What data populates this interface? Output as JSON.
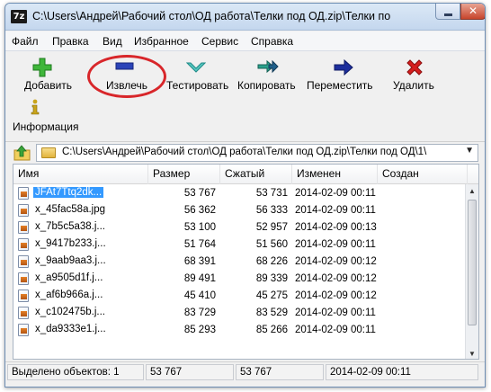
{
  "window": {
    "title": "C:\\Users\\Андрей\\Рабочий стол\\ОД работа\\Телки под ОД.zip\\Телки по",
    "app_icon_text": "7z",
    "close_glyph": "✕"
  },
  "menu": [
    "Файл",
    "Правка",
    "Вид",
    "Избранное",
    "Сервис",
    "Справка"
  ],
  "toolbar": {
    "add": "Добавить",
    "extract": "Извлечь",
    "test": "Тестировать",
    "copy": "Копировать",
    "move": "Переместить",
    "delete": "Удалить",
    "info": "Информация",
    "highlight_color": "#d8262a"
  },
  "address": {
    "path": "C:\\Users\\Андрей\\Рабочий стол\\ОД работа\\Телки под ОД.zip\\Телки под ОД\\1\\",
    "dropdown_glyph": "▼"
  },
  "columns": [
    "Имя",
    "Размер",
    "Сжатый",
    "Изменен",
    "Создан"
  ],
  "files": [
    {
      "name": "JFAt7Ttq2dk...",
      "size": "53 767",
      "packed": "53 731",
      "modified": "2014-02-09 00:11",
      "selected": true
    },
    {
      "name": "x_45fac58a.jpg",
      "size": "56 362",
      "packed": "56 333",
      "modified": "2014-02-09 00:11",
      "selected": false
    },
    {
      "name": "x_7b5c5a38.j...",
      "size": "53 100",
      "packed": "52 957",
      "modified": "2014-02-09 00:13",
      "selected": false
    },
    {
      "name": "x_9417b233.j...",
      "size": "51 764",
      "packed": "51 560",
      "modified": "2014-02-09 00:11",
      "selected": false
    },
    {
      "name": "x_9aab9aa3.j...",
      "size": "68 391",
      "packed": "68 226",
      "modified": "2014-02-09 00:12",
      "selected": false
    },
    {
      "name": "x_a9505d1f.j...",
      "size": "89 491",
      "packed": "89 339",
      "modified": "2014-02-09 00:12",
      "selected": false
    },
    {
      "name": "x_af6b966a.j...",
      "size": "45 410",
      "packed": "45 275",
      "modified": "2014-02-09 00:12",
      "selected": false
    },
    {
      "name": "x_c102475b.j...",
      "size": "83 729",
      "packed": "83 529",
      "modified": "2014-02-09 00:11",
      "selected": false
    },
    {
      "name": "x_da9333e1.j...",
      "size": "85 293",
      "packed": "85 266",
      "modified": "2014-02-09 00:11",
      "selected": false
    }
  ],
  "status": {
    "selected": "Выделено объектов: 1",
    "size": "53 767",
    "packed": "53 767",
    "modified": "2014-02-09 00:11"
  }
}
